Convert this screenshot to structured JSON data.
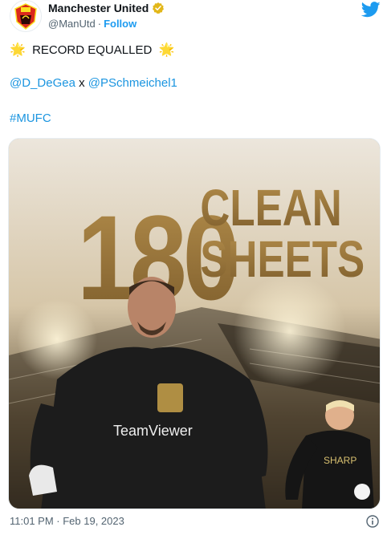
{
  "account": {
    "display_name": "Manchester United",
    "handle": "@ManUtd",
    "separator": "·",
    "follow_label": "Follow"
  },
  "tweet": {
    "headline": "RECORD EQUALLED",
    "mention_1": "@D_DeGea",
    "connector": "x",
    "mention_2": "@PSchmeichel1",
    "hashtag": "#MUFC",
    "timestamp": "11:01 PM · Feb 19, 2023"
  },
  "media": {
    "big_number": "180",
    "word_1": "CLEAN",
    "word_2": "SHEETS",
    "sponsor": "TeamViewer",
    "sponsor_2": "SHARP"
  },
  "icons": {
    "sun": "sun-emoji",
    "verified": "verified-badge-icon",
    "brand": "twitter-bird-icon",
    "info": "info-icon"
  },
  "colors": {
    "link": "#1b95e0",
    "twitter_blue": "#1d9bf0",
    "verified_gold": "#e2b719",
    "gold_text": "#8a6a33"
  }
}
